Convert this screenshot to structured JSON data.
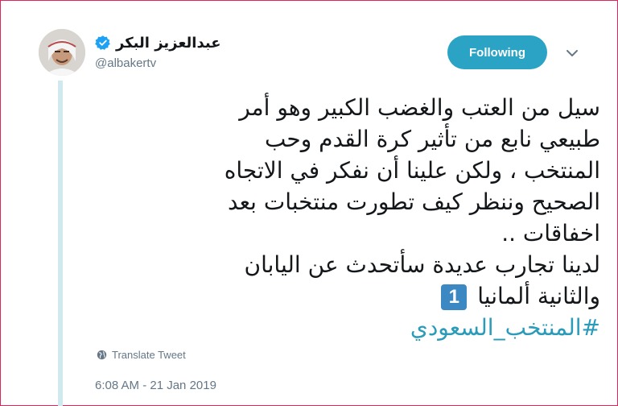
{
  "author": {
    "display_name": "عبدالعزيز البكر",
    "handle": "@albakertv",
    "verified": true
  },
  "actions": {
    "follow_label": "Following"
  },
  "tweet": {
    "lines": [
      "سيل من العتب والغضب الكبير  وهو أمر",
      "طبيعي نابع من تأثير كرة القدم وحب",
      "المنتخب ، ولكن علينا أن نفكر في الاتجاه",
      "الصحيح وننظر كيف تطورت منتخبات بعد",
      "اخفاقات ..",
      "لدينا تجارب عديدة سأتحدث عن اليابان"
    ],
    "last_line_text": "والثانية ألمانيا",
    "emoji_digit": "1",
    "hashtag": "#المنتخب_السعودي"
  },
  "translate_label": "Translate Tweet",
  "timestamp": "6:08 AM - 21 Jan 2019",
  "colors": {
    "follow_button": "#2aa3c4",
    "hashtag": "#2a9bb8",
    "verified_badge": "#1da1f2",
    "thread_line": "#cfe9ee",
    "frame_border": "#e0245e"
  }
}
